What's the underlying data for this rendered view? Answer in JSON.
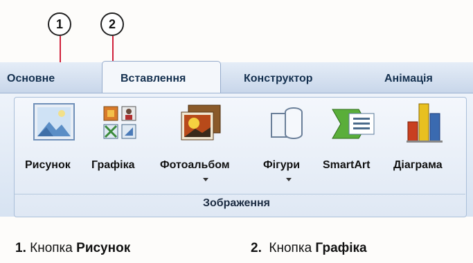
{
  "callouts": [
    "1",
    "2"
  ],
  "tabs": [
    "Основне",
    "Вставлення",
    "Конструктор",
    "Анімація"
  ],
  "buttons": [
    {
      "label": "Рисунок",
      "icon": "picture-icon"
    },
    {
      "label": "Графіка",
      "icon": "clipart-icon"
    },
    {
      "label": "Фотоальбом",
      "icon": "photo-album-icon"
    },
    {
      "label": "Фігури",
      "icon": "shapes-icon"
    },
    {
      "label": "SmartArt",
      "icon": "smartart-icon"
    },
    {
      "label": "Діаграма",
      "icon": "chart-icon"
    }
  ],
  "group_label": "Зображення",
  "captions": [
    {
      "num": "1.",
      "text": "Кнопка",
      "bold": "Рисунок"
    },
    {
      "num": "2.",
      "text": "Кнопка",
      "bold": "Графіка"
    }
  ],
  "colors": {
    "pointer": "#d0203a",
    "tab_text": "#14304f"
  }
}
